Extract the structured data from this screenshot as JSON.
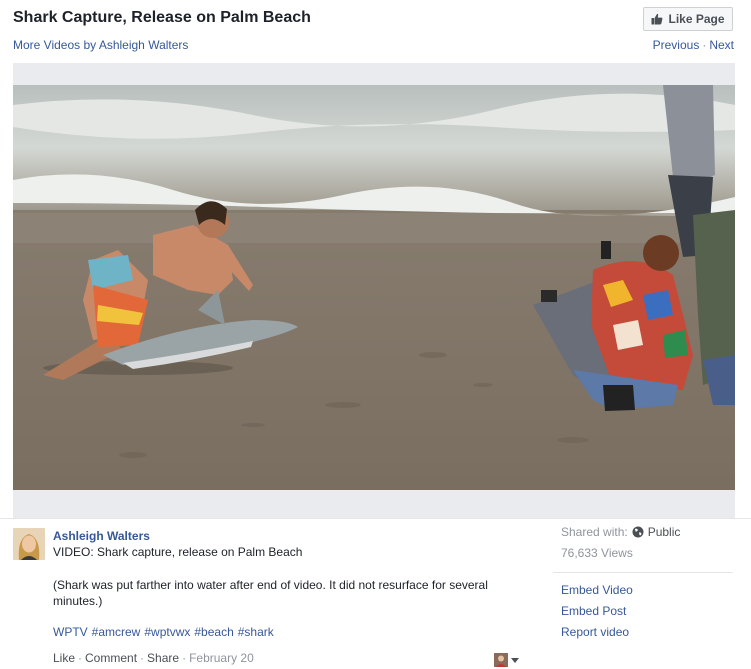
{
  "header": {
    "title": "Shark Capture, Release on Palm Beach",
    "more_videos": "More Videos by Ashleigh Walters",
    "like_page": "Like Page",
    "previous": "Previous",
    "separator": "·",
    "next": "Next"
  },
  "video": {
    "thumbnail_icon": "video-frame"
  },
  "post": {
    "author": "Ashleigh Walters",
    "caption": "VIDEO: Shark capture, release on Palm Beach",
    "note": "(Shark was put farther into water after end of video. It did not resurface for several minutes.)",
    "hashtags": [
      "WPTV",
      "#amcrew",
      "#wptvwx",
      "#beach",
      "#shark"
    ],
    "actions": {
      "like": "Like",
      "comment": "Comment",
      "share": "Share",
      "date": "February 20",
      "separator": "·"
    }
  },
  "sidebar": {
    "shared_with_label": "Shared with:",
    "privacy": "Public",
    "views": "76,633 Views",
    "links": [
      "Embed Video",
      "Embed Post",
      "Report video"
    ]
  },
  "colors": {
    "link": "#365899",
    "text": "#1d2129",
    "muted": "#90949c",
    "frame": "#e9ebee"
  }
}
